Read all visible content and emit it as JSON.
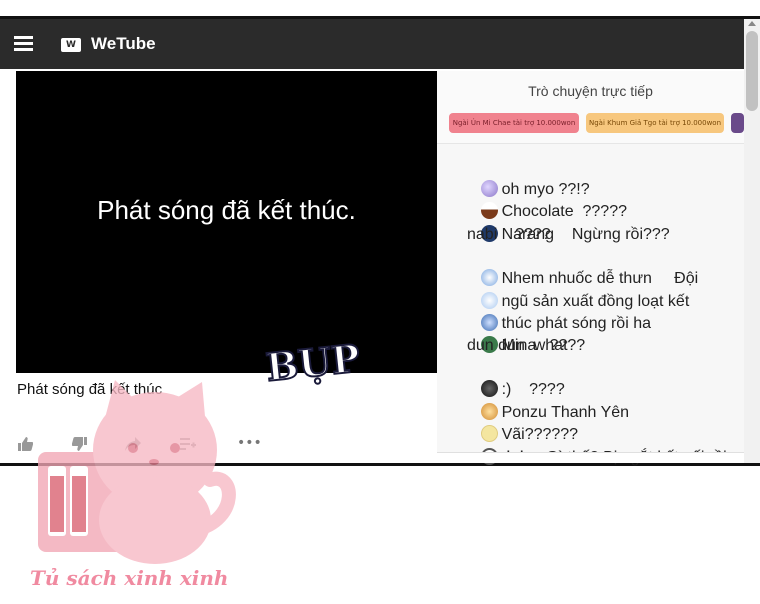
{
  "app": {
    "logo_letter": "W",
    "name": "WeTube"
  },
  "player": {
    "overlay_text": "Phát sóng đã kết thúc."
  },
  "video": {
    "title": "Phát sóng đã kết thúc"
  },
  "chat": {
    "title": "Trò chuyện trực tiếp",
    "donations": [
      {
        "text": "Ngài Ún Mi Chae tài trợ 10.000won",
        "color": "#f0828e"
      },
      {
        "text": "Ngài Khum Giả Tgo tài trợ 10.000won",
        "color": "#f7c77e"
      }
    ],
    "messages": [
      {
        "text": "oh myo ??!?",
        "avatar_color": "#b7a6e0"
      },
      {
        "text": "Chocolate  ?????",
        "avatar_color": "#8a4a2a"
      },
      {
        "text": "Narang    Ngừng rồi???",
        "avatar_color": "#1f3a6a"
      },
      {
        "text": "nabi    ????",
        "avatar_color": null
      },
      {
        "text": "Nhem nhuốc dễ thưn     Đội",
        "avatar_color": "#9ab6e0"
      },
      {
        "text": "ngũ sản xuất đồng loạt kết",
        "avatar_color": "#a8c8f0"
      },
      {
        "text": "thúc phát sóng rồi ha",
        "avatar_color": "#4a7ac0"
      },
      {
        "text": "Mina   ????",
        "avatar_color": "#3a7a4a"
      },
      {
        "text": "dun dun  what",
        "avatar_color": null
      },
      {
        "text": ":)    ????",
        "avatar_color": "#222222"
      },
      {
        "text": "Ponzu Thanh Yên",
        "avatar_color": "#e0a040"
      },
      {
        "text": "Vãi??????",
        "avatar_color": "#f4e6a0"
      },
      {
        "text": "※※    Gì thế? Bị ngắt kết nối rồi",
        "avatar_color": "#ffffff"
      }
    ]
  },
  "actions": [
    {
      "icon": "thumbs-up-icon"
    },
    {
      "icon": "thumbs-down-icon"
    },
    {
      "icon": "share-icon"
    },
    {
      "icon": "add-to-playlist-icon"
    },
    {
      "icon": "more-icon",
      "label": "•••"
    }
  ],
  "overlay": {
    "sfx_text": "BỤP",
    "watermark_text": "Tủ sách xinh xinh"
  }
}
